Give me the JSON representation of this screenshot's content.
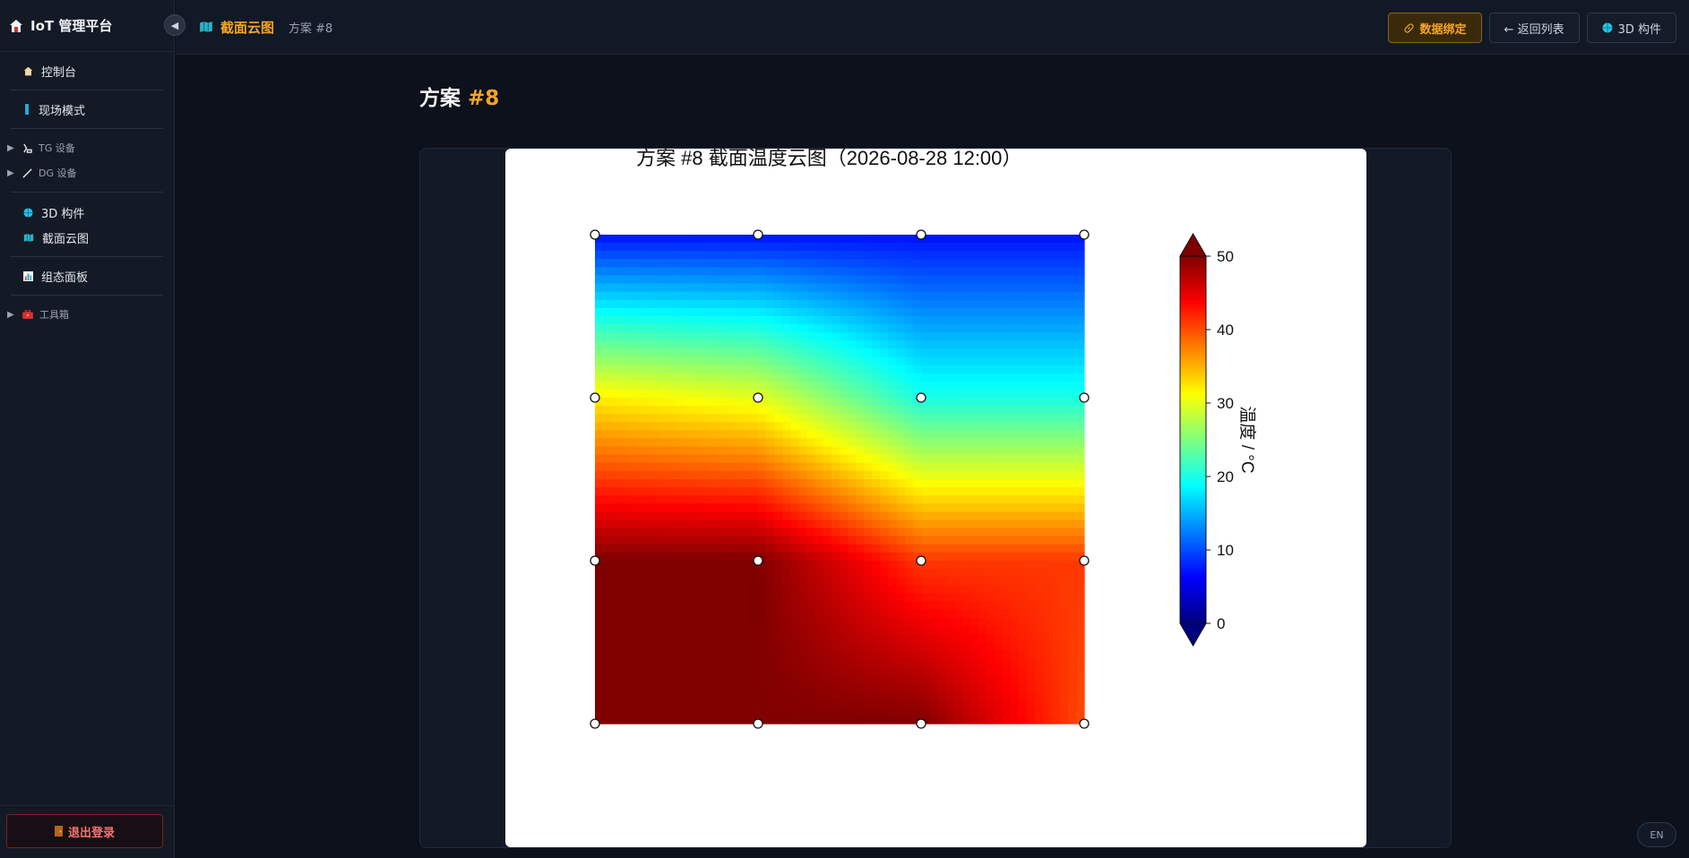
{
  "app": {
    "title": "IoT 管理平台",
    "collapse_glyph": "◀"
  },
  "sidebar": {
    "items": [
      {
        "label": "控制台",
        "icon": "home-icon"
      },
      {
        "label": "现场模式",
        "icon": "sensor-icon"
      },
      {
        "label": "TG 设备",
        "icon": "tg-device-icon",
        "group": true
      },
      {
        "label": "DG 设备",
        "icon": "dg-device-icon",
        "group": true
      },
      {
        "label": "3D 构件",
        "icon": "globe-icon"
      },
      {
        "label": "截面云图",
        "icon": "map-icon"
      },
      {
        "label": "组态面板",
        "icon": "chart-icon"
      },
      {
        "label": "工具箱",
        "icon": "toolbox-icon",
        "group": true
      }
    ],
    "logout_label": "退出登录"
  },
  "topbar": {
    "title": "截面云图",
    "subtitle": "方案 #8",
    "actions": {
      "bind": "数据绑定",
      "back": "← 返回列表",
      "model": "3D 构件"
    }
  },
  "page": {
    "title_prefix": "方案",
    "title_highlight": "#8"
  },
  "lang_toggle": "EN",
  "chart_data": {
    "type": "heatmap",
    "title": "方案 #8  截面温度云图（2026-08-28 12:00）",
    "colorbar_label": "温度 / °C",
    "colorbar_ticks": [
      0,
      10,
      20,
      30,
      40,
      50
    ],
    "vmin": 0,
    "vmax": 50,
    "colormap": "jet",
    "grid_x": [
      0,
      1,
      2,
      3
    ],
    "grid_y": [
      0,
      1,
      2,
      3
    ],
    "values": [
      [
        7,
        7,
        7,
        7
      ],
      [
        32,
        30,
        20,
        20
      ],
      [
        50,
        50,
        41,
        41
      ],
      [
        50,
        50,
        50,
        40
      ]
    ]
  }
}
